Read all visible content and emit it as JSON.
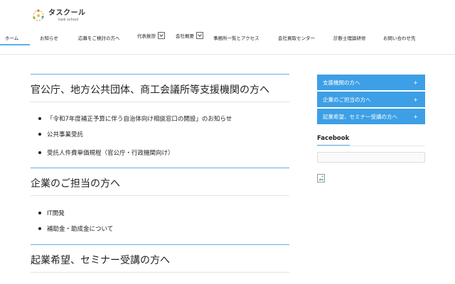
{
  "header": {
    "logo_title": "タスクール",
    "logo_sub": "task school",
    "nav": [
      {
        "label": "ホーム"
      },
      {
        "label": "お知らせ"
      },
      {
        "label": "応募をご検討の方へ"
      },
      {
        "label": "代表挨拶"
      },
      {
        "label": "会社概要"
      },
      {
        "label": "事務所一覧とアクセス"
      },
      {
        "label": "会社買取センター"
      },
      {
        "label": "診断士理論研修"
      },
      {
        "label": "お問い合わせ先"
      }
    ]
  },
  "main": {
    "sections": [
      {
        "title": "官公庁、地方公共団体、商工会議所等支援機関の方へ",
        "items": [
          "「令和7年度補正予算に伴う自治体向け相談窓口の開設」のお知らせ",
          "公共事業受託",
          "受託人件費単価規程（官公庁・行政機関向け）"
        ]
      },
      {
        "title": "企業のご担当の方へ",
        "items": [
          "IT開発",
          "補助金・助成金について"
        ]
      },
      {
        "title": "起業希望、セミナー受講の方へ",
        "items": []
      }
    ]
  },
  "sidebar": {
    "menu": [
      {
        "label": "支援機関の方へ",
        "toggle": "+"
      },
      {
        "label": "企業のご担当の方へ",
        "toggle": "+"
      },
      {
        "label": "起業希望、セミナー受講の方へ",
        "toggle": "+"
      }
    ],
    "facebook_title": "Facebook"
  },
  "colors": {
    "accent": "#3d9fe6",
    "rule": "#5bb0e8"
  }
}
